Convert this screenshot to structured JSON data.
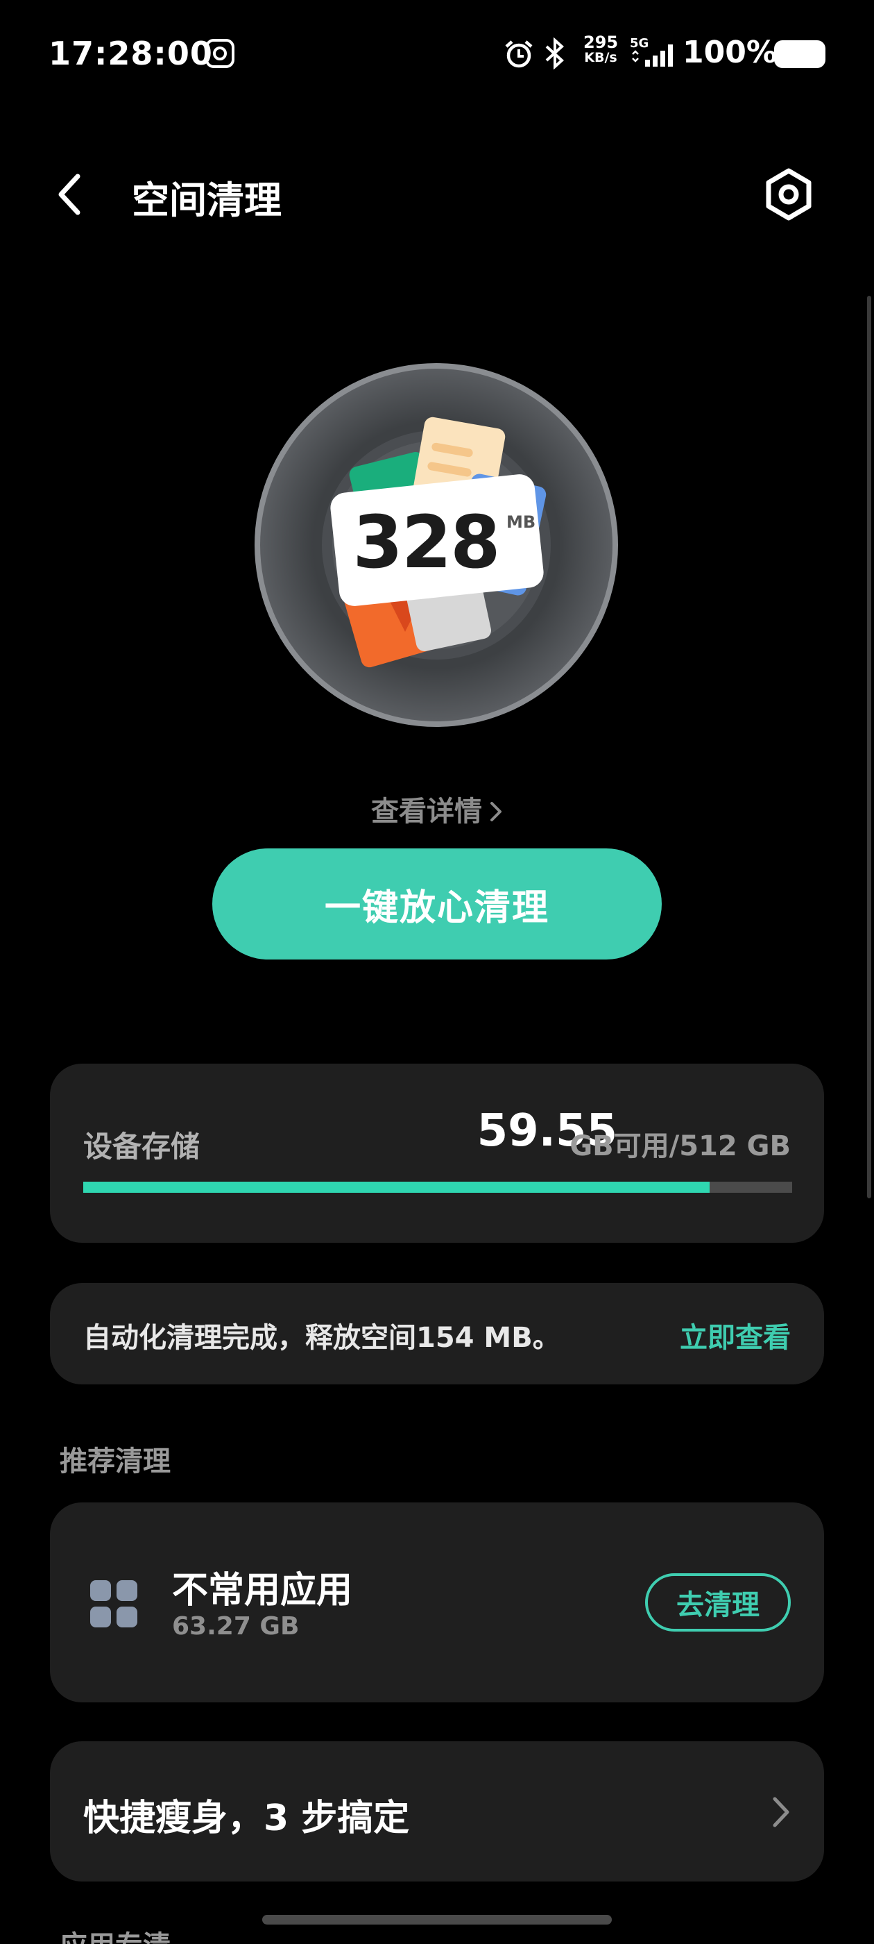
{
  "status_bar": {
    "time": "17:28:00",
    "speed_value": "295",
    "speed_unit": "KB/s",
    "network": "5G",
    "battery": "100%"
  },
  "header": {
    "title": "空间清理"
  },
  "hero": {
    "junk_value": "328",
    "junk_unit": "MB"
  },
  "details_link": "查看详情",
  "clean_button": "一键放心清理",
  "storage": {
    "label": "设备存储",
    "free_value": "59.55",
    "free_suffix": "GB可用/512 GB",
    "used_fraction": 0.884
  },
  "auto_clean": {
    "text": "自动化清理完成，释放空间154 MB。",
    "link": "立即查看"
  },
  "recommend": {
    "section_title": "推荐清理",
    "app_name": "不常用应用",
    "app_size": "63.27 GB",
    "button": "去清理"
  },
  "quick": {
    "text": "快捷瘦身，3 步搞定"
  },
  "next_section": "应用专清",
  "colors": {
    "accent": "#3fcdb0",
    "card": "#1f1f1f",
    "background": "#000000"
  }
}
